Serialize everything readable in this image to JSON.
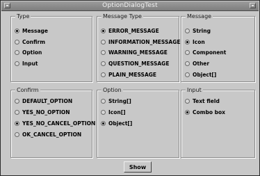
{
  "window": {
    "title": "OptionDialogTest"
  },
  "groups": {
    "type": {
      "legend": "Type",
      "options": [
        {
          "label": "Message",
          "selected": true
        },
        {
          "label": "Confirm",
          "selected": false
        },
        {
          "label": "Option",
          "selected": false
        },
        {
          "label": "Input",
          "selected": false
        }
      ]
    },
    "message_type": {
      "legend": "Message Type",
      "options": [
        {
          "label": "ERROR_MESSAGE",
          "selected": true
        },
        {
          "label": "INFORMATION_MESSAGE",
          "selected": false
        },
        {
          "label": "WARNING_MESSAGE",
          "selected": false
        },
        {
          "label": "QUESTION_MESSAGE",
          "selected": false
        },
        {
          "label": "PLAIN_MESSAGE",
          "selected": false
        }
      ]
    },
    "message": {
      "legend": "Message",
      "options": [
        {
          "label": "String",
          "selected": false
        },
        {
          "label": "Icon",
          "selected": true
        },
        {
          "label": "Component",
          "selected": false
        },
        {
          "label": "Other",
          "selected": false
        },
        {
          "label": "Object[]",
          "selected": false
        }
      ]
    },
    "confirm": {
      "legend": "Confirm",
      "options": [
        {
          "label": "DEFAULT_OPTION",
          "selected": false
        },
        {
          "label": "YES_NO_OPTION",
          "selected": false
        },
        {
          "label": "YES_NO_CANCEL_OPTION",
          "selected": true
        },
        {
          "label": "OK_CANCEL_OPTION",
          "selected": false
        }
      ]
    },
    "option": {
      "legend": "Option",
      "options": [
        {
          "label": "String[]",
          "selected": false
        },
        {
          "label": "Icon[]",
          "selected": false
        },
        {
          "label": "Object[]",
          "selected": true
        }
      ]
    },
    "input": {
      "legend": "Input",
      "options": [
        {
          "label": "Text field",
          "selected": false
        },
        {
          "label": "Combo box",
          "selected": true
        }
      ]
    }
  },
  "buttons": {
    "show": "Show"
  }
}
